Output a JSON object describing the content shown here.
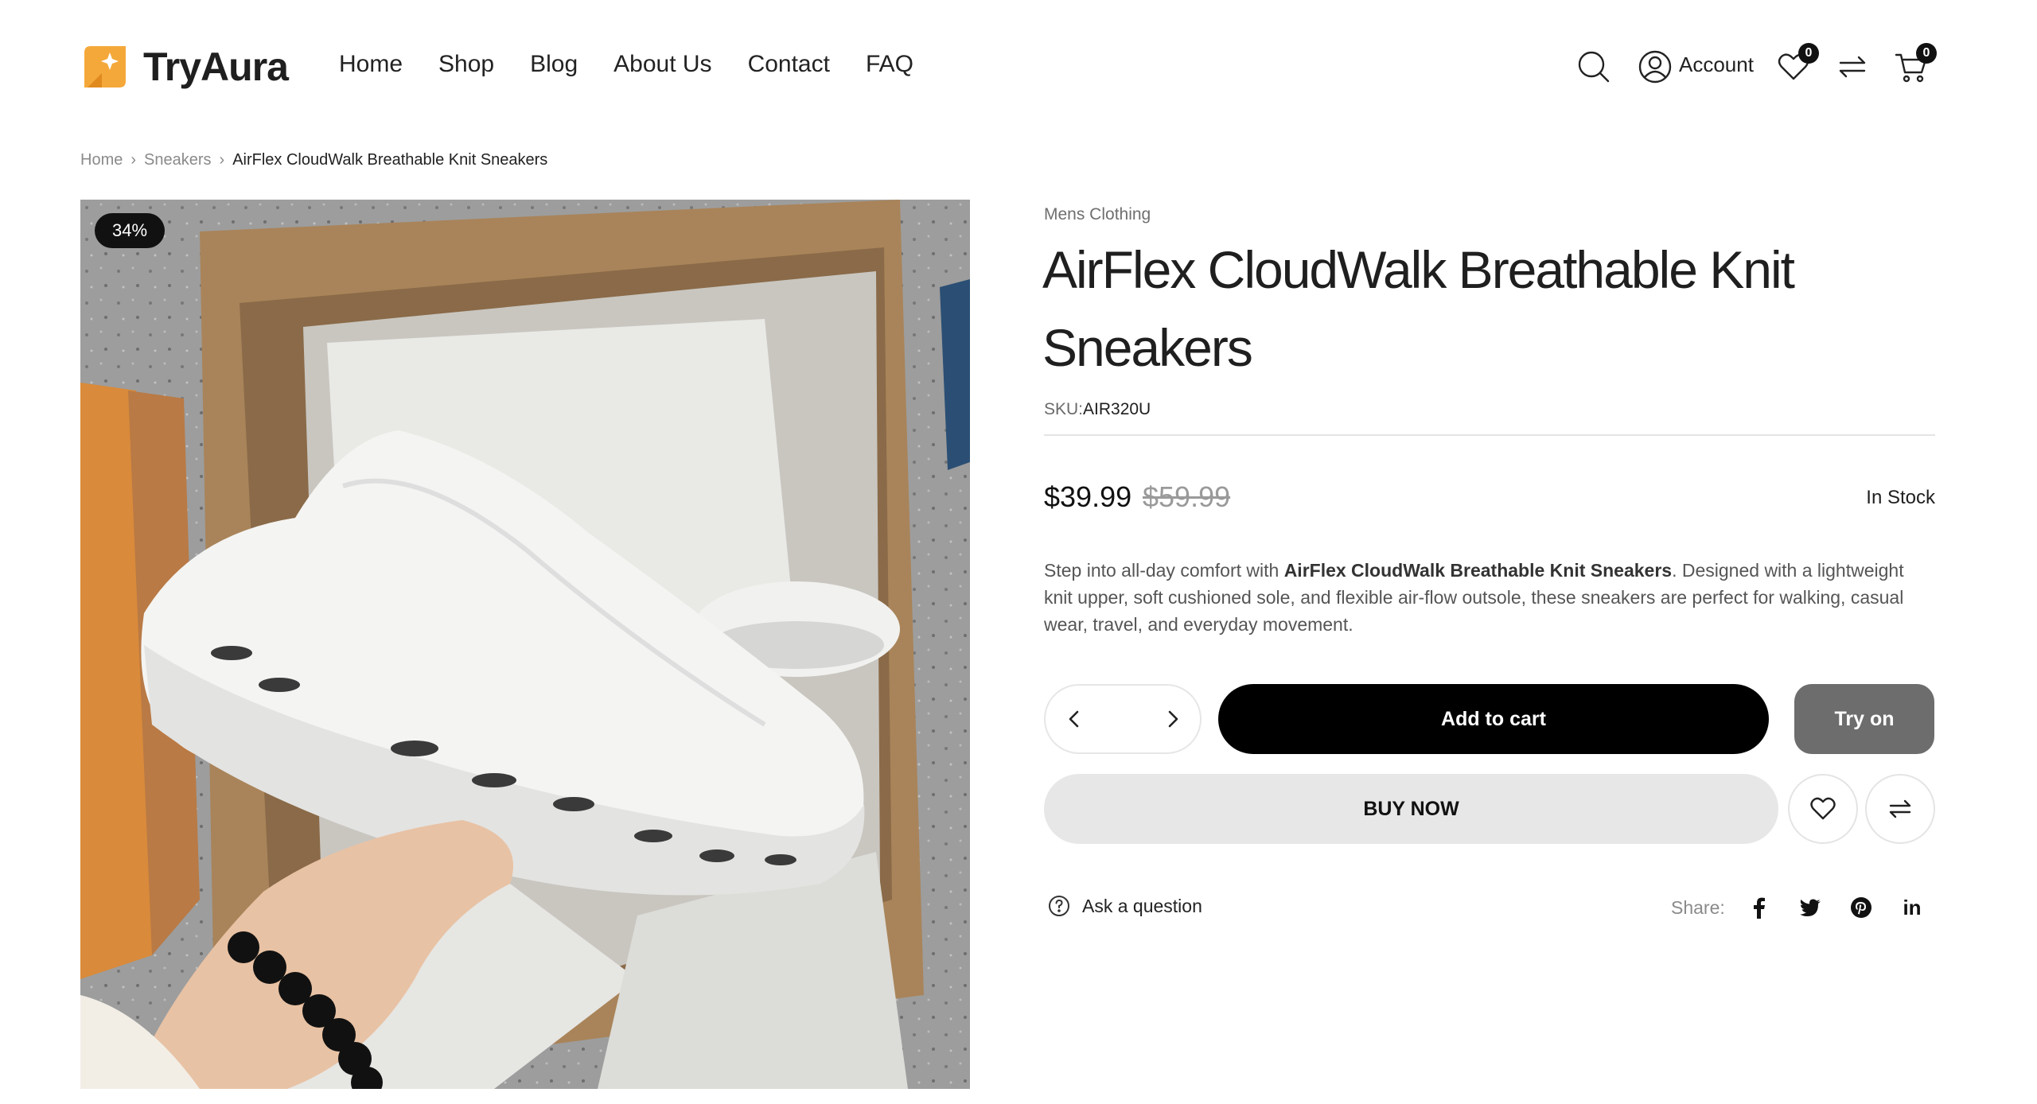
{
  "brand": {
    "name": "TryAura",
    "accent": "#f5a83a"
  },
  "nav": [
    {
      "label": "Home"
    },
    {
      "label": "Shop"
    },
    {
      "label": "Blog"
    },
    {
      "label": "About Us"
    },
    {
      "label": "Contact"
    },
    {
      "label": "FAQ"
    }
  ],
  "header": {
    "account_label": "Account",
    "wishlist_count": "0",
    "cart_count": "0",
    "icons": [
      "search-icon",
      "user-icon",
      "heart-icon",
      "compare-icon",
      "cart-icon"
    ]
  },
  "breadcrumb": [
    {
      "label": "Home"
    },
    {
      "label": "Sneakers"
    },
    {
      "label": "AirFlex CloudWalk Breathable Knit Sneakers"
    }
  ],
  "product": {
    "discount_badge": "34%",
    "category": "Mens Clothing",
    "title": "AirFlex CloudWalk Breathable Knit Sneakers",
    "sku_label": "SKU:",
    "sku": "AIR320U",
    "price": "$39.99",
    "old_price": "$59.99",
    "stock": "In Stock",
    "description_start": "Step into all-day comfort with ",
    "description_bold": "AirFlex CloudWalk Breathable Knit Sneakers",
    "description_end": ". Designed with a lightweight knit upper, soft cushioned sole, and flexible air-flow outsole, these sneakers are perfect for walking, casual wear, travel, and everyday movement.",
    "quantity": ""
  },
  "buttons": {
    "add_to_cart": "Add to cart",
    "try_on": "Try on",
    "buy_now": "BUY NOW"
  },
  "footer_actions": {
    "ask_question": "Ask a question",
    "share_label": "Share:",
    "share_networks": [
      "facebook-icon",
      "twitter-icon",
      "pinterest-icon",
      "linkedin-icon"
    ],
    "linkedin_text": "in"
  }
}
